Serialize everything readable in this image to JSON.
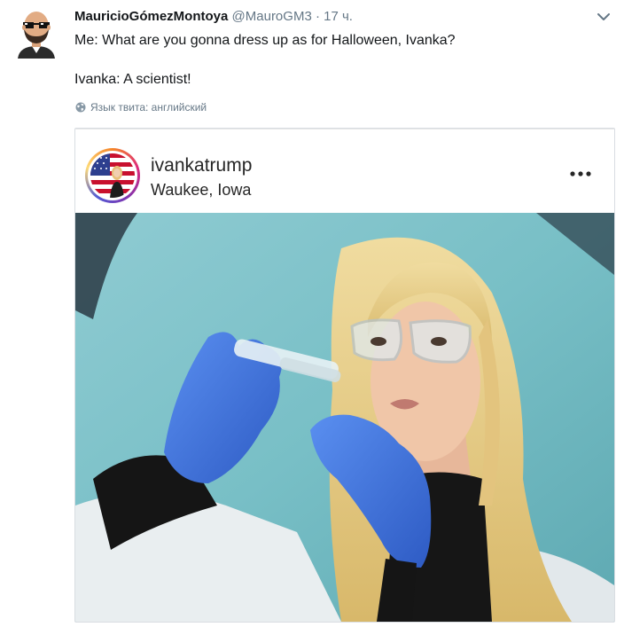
{
  "tweet": {
    "display_name": "MauricioGómezMontoya",
    "handle": "@MauroGM3",
    "separator": "·",
    "time": "17 ч.",
    "line1": "Me: What are you gonna dress up as for Halloween, Ivanka?",
    "line2": "Ivanka: A scientist!",
    "language_note": "Язык твита: английский",
    "avatar_icon": "bitmoji-avatar-sunglasses-icon",
    "menu_icon": "chevron-down-icon",
    "globe_icon": "globe-icon"
  },
  "instagram_card": {
    "username": "ivankatrump",
    "location": "Waukee, Iowa",
    "more_icon": "more-dots-icon",
    "photo_description_icon": "scientist-photo-image"
  },
  "colors": {
    "text": "#14171a",
    "secondary": "#657786",
    "glove_blue": "#3f6fd8",
    "background_teal": "#79c2c9"
  }
}
